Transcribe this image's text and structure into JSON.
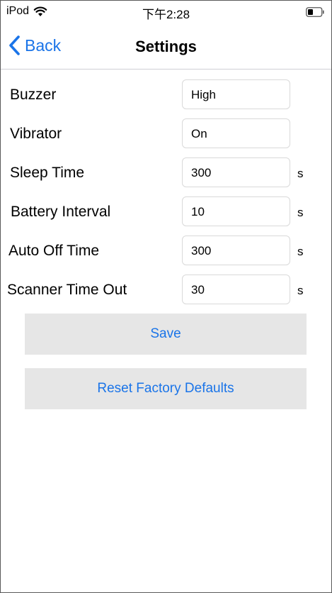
{
  "status_bar": {
    "device": "iPod",
    "time": "下午2:28",
    "wifi_icon": "wifi-icon",
    "battery_icon": "battery-icon"
  },
  "nav": {
    "back_label": "Back",
    "back_icon": "chevron-left-icon",
    "title": "Settings"
  },
  "settings": {
    "buzzer": {
      "label": "Buzzer",
      "value": "High",
      "unit": ""
    },
    "vibrator": {
      "label": "Vibrator",
      "value": "On",
      "unit": ""
    },
    "sleep_time": {
      "label": "Sleep Time",
      "value": "300",
      "unit": "s"
    },
    "battery_interval": {
      "label": "Battery Interval",
      "value": "10",
      "unit": "s"
    },
    "auto_off_time": {
      "label": "Auto Off Time",
      "value": "300",
      "unit": "s"
    },
    "scanner_time_out": {
      "label": "Scanner Time Out",
      "value": "30",
      "unit": "s"
    }
  },
  "actions": {
    "save_label": "Save",
    "reset_label": "Reset Factory Defaults"
  },
  "colors": {
    "accent": "#1a74e8",
    "button_bg": "#e6e6e6",
    "field_border": "#d9d9d9"
  }
}
